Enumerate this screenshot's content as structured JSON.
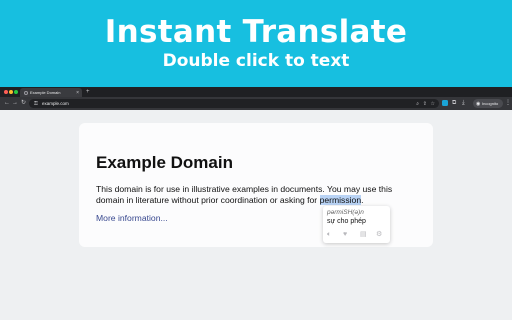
{
  "banner": {
    "title": "Instant Translate",
    "subtitle": "Double click to text",
    "background": "#17bfe0"
  },
  "browser": {
    "tab_title": "Example Domain",
    "tab_close": "×",
    "new_tab": "+",
    "nav": {
      "back": "←",
      "forward": "→",
      "reload": "↻"
    },
    "url": "example.com",
    "incognito_label": "Incognito",
    "icons": [
      "lock-icon",
      "zoom-icon",
      "share-icon",
      "star-icon",
      "extension-icon",
      "puzzle-icon",
      "download-icon",
      "incognito-icon",
      "menu-icon"
    ]
  },
  "page": {
    "title": "Example Domain",
    "paragraph_before": "This domain is for use in illustrative examples in documents. You may use this domain in literature without prior coordination or asking for ",
    "selected_word": "permission",
    "paragraph_after": ".",
    "more_link": "More information..."
  },
  "popup": {
    "phonetic": "pərmiSH(ə)n",
    "translation": "sự cho phép",
    "icons": [
      "speaker-icon",
      "heart-icon",
      "book-icon",
      "gear-icon"
    ]
  }
}
